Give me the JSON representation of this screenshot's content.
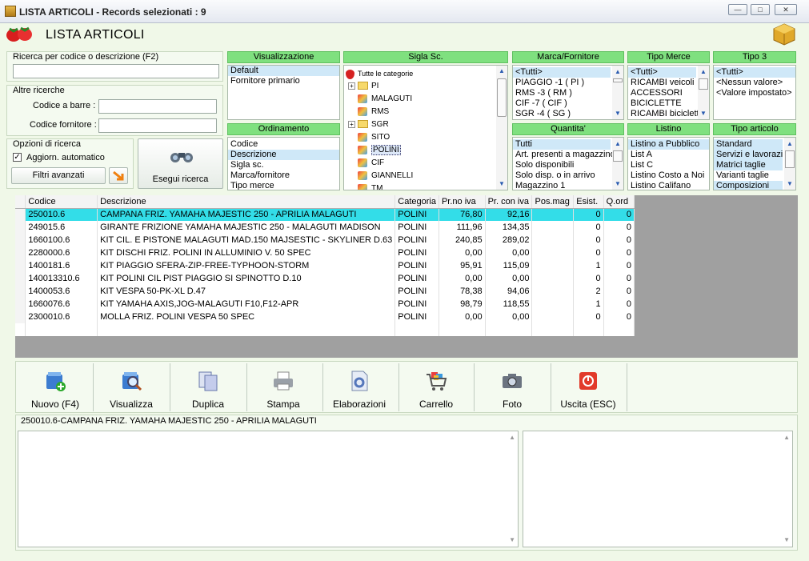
{
  "window": {
    "title": "LISTA ARTICOLI - Records selezionati : 9"
  },
  "header": {
    "title": "LISTA ARTICOLI"
  },
  "search": {
    "main_label": "Ricerca per codice o descrizione (F2)",
    "main_value": "",
    "other_label": "Altre ricerche",
    "barcode_label": "Codice a barre :",
    "barcode_value": "",
    "supplier_code_label": "Codice fornitore :",
    "supplier_code_value": "",
    "options_label": "Opzioni di ricerca",
    "auto_update_label": "Aggiorn. automatico",
    "advanced_filters_label": "Filtri avanzati",
    "execute_label": "Esegui ricerca"
  },
  "visualizzazione": {
    "title": "Visualizzazione",
    "items": [
      "Default",
      "Fornitore primario"
    ],
    "selected": 0
  },
  "ordinamento": {
    "title": "Ordinamento",
    "items": [
      "Codice",
      "Descrizione",
      "Sigla sc.",
      "Marca/fornitore",
      "Tipo merce"
    ],
    "selected": 1
  },
  "sigla": {
    "title": "Sigla Sc.",
    "root": "Tutte le categorie",
    "items": [
      "PI",
      "MALAGUTI",
      "RMS",
      "SGR",
      "SITO",
      "POLINI",
      "CIF",
      "GIANNELLI",
      "TM"
    ],
    "selected": "POLINI"
  },
  "marca": {
    "title": "Marca/Fornitore",
    "items": [
      "<Tutti>",
      "PIAGGIO -1 ( PI )",
      "RMS -3 ( RM )",
      "CIF -7 ( CIF )",
      "SGR -4 ( SG )"
    ]
  },
  "tipo_merce": {
    "title": "Tipo Merce",
    "items": [
      "<Tutti>",
      "RICAMBI veicoli",
      "ACCESSORI",
      "BICICLETTE",
      "RICAMBI biciclett"
    ]
  },
  "tipo3": {
    "title": "Tipo 3",
    "items": [
      "<Tutti>",
      "<Nessun valore>",
      "<Valore impostato>"
    ]
  },
  "quantita": {
    "title": "Quantita'",
    "items": [
      "Tutti",
      "Art. presenti a magazzino",
      "Solo disponibili",
      "Solo disp. o in arrivo",
      "Magazzino 1"
    ]
  },
  "listino": {
    "title": "Listino",
    "items": [
      "Listino a Pubblico",
      "List A",
      "List C",
      "Listino Costo a Noi",
      "Listino Califano"
    ]
  },
  "tipo_articolo": {
    "title": "Tipo articolo",
    "items": [
      "Standard",
      "Servizi e lavorazio",
      "Matrici taglie",
      "Varianti taglie",
      "Composizioni"
    ]
  },
  "table": {
    "columns": [
      "Codice",
      "Descrizione",
      "Categoria",
      "Pr.no iva",
      "Pr. con iva",
      "Pos.mag",
      "Esist.",
      "Q.ord"
    ],
    "rows": [
      [
        "250010.6",
        "CAMPANA FRIZ. YAMAHA MAJESTIC 250 - APRILIA MALAGUTI",
        "POLINI",
        "76,80",
        "92,16",
        "",
        "0",
        "0"
      ],
      [
        "249015.6",
        "GIRANTE FRIZIONE YAMAHA MAJESTIC 250 - MALAGUTI MADISON",
        "POLINI",
        "111,96",
        "134,35",
        "",
        "0",
        "0"
      ],
      [
        "1660100.6",
        "KIT CIL. E PISTONE MALAGUTI MAD.150 MAJSESTIC - SKYLINER  D.63",
        "POLINI",
        "240,85",
        "289,02",
        "",
        "0",
        "0"
      ],
      [
        "2280000.6",
        "KIT DISCHI FRIZ. POLINI IN ALLUMINIO V. 50 SPEC",
        "POLINI",
        "0,00",
        "0,00",
        "",
        "0",
        "0"
      ],
      [
        "1400181.6",
        "KIT PIAGGIO SFERA-ZIP-FREE-TYPHOON-STORM",
        "POLINI",
        "95,91",
        "115,09",
        "",
        "1",
        "0"
      ],
      [
        "140013310.6",
        "KIT POLINI CIL PIST PIAGGIO SI SPINOTTO D.10",
        "POLINI",
        "0,00",
        "0,00",
        "",
        "0",
        "0"
      ],
      [
        "1400053.6",
        "KIT VESPA 50-PK-XL D.47",
        "POLINI",
        "78,38",
        "94,06",
        "",
        "2",
        "0"
      ],
      [
        "1660076.6",
        "KIT YAMAHA AXIS,JOG-MALAGUTI F10,F12-APR",
        "POLINI",
        "98,79",
        "118,55",
        "",
        "1",
        "0"
      ],
      [
        "2300010.6",
        "MOLLA FRIZ. POLINI  VESPA 50 SPEC",
        "POLINI",
        "0,00",
        "0,00",
        "",
        "0",
        "0"
      ]
    ]
  },
  "toolbar": {
    "nuovo": "Nuovo (F4)",
    "visualizza": "Visualizza",
    "duplica": "Duplica",
    "stampa": "Stampa",
    "elaborazioni": "Elaborazioni",
    "carrello": "Carrello",
    "foto": "Foto",
    "uscita": "Uscita (ESC)"
  },
  "detail": {
    "selected_text": "250010.6-CAMPANA FRIZ. YAMAHA MAJESTIC 250 - APRILIA MALAGUTI"
  }
}
